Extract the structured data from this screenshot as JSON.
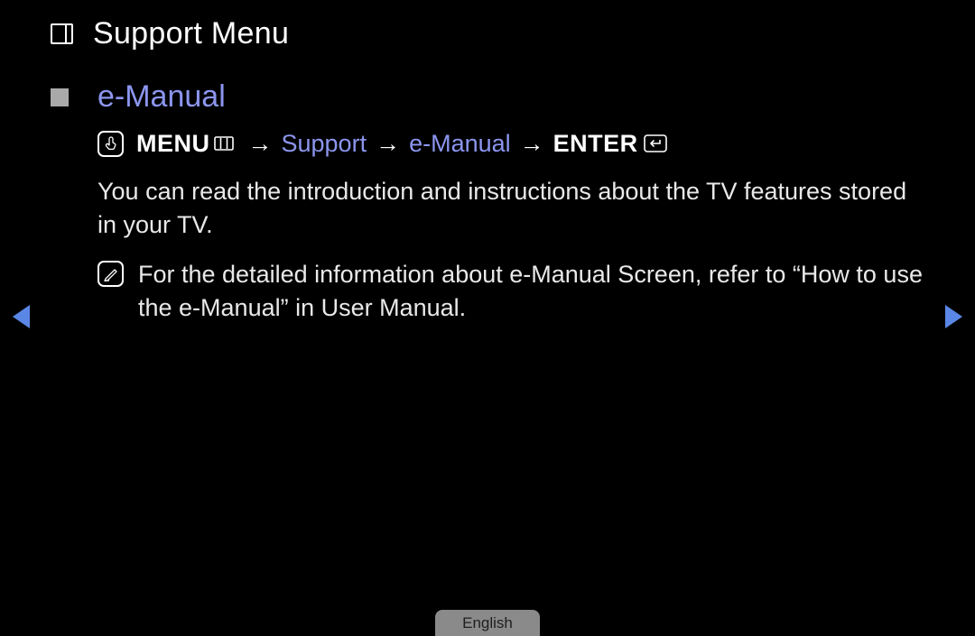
{
  "chapter": {
    "title": "Support Menu"
  },
  "section": {
    "title": "e-Manual"
  },
  "path": {
    "menu_label": "MENU",
    "arrow": "→",
    "item1": "Support",
    "item2": "e-Manual",
    "enter_label": "ENTER"
  },
  "description": "You can read the introduction and instructions about the TV features stored in your TV.",
  "note": "For the detailed information about e-Manual Screen, refer to “How to use the e-Manual” in User Manual.",
  "language_badge": "English"
}
